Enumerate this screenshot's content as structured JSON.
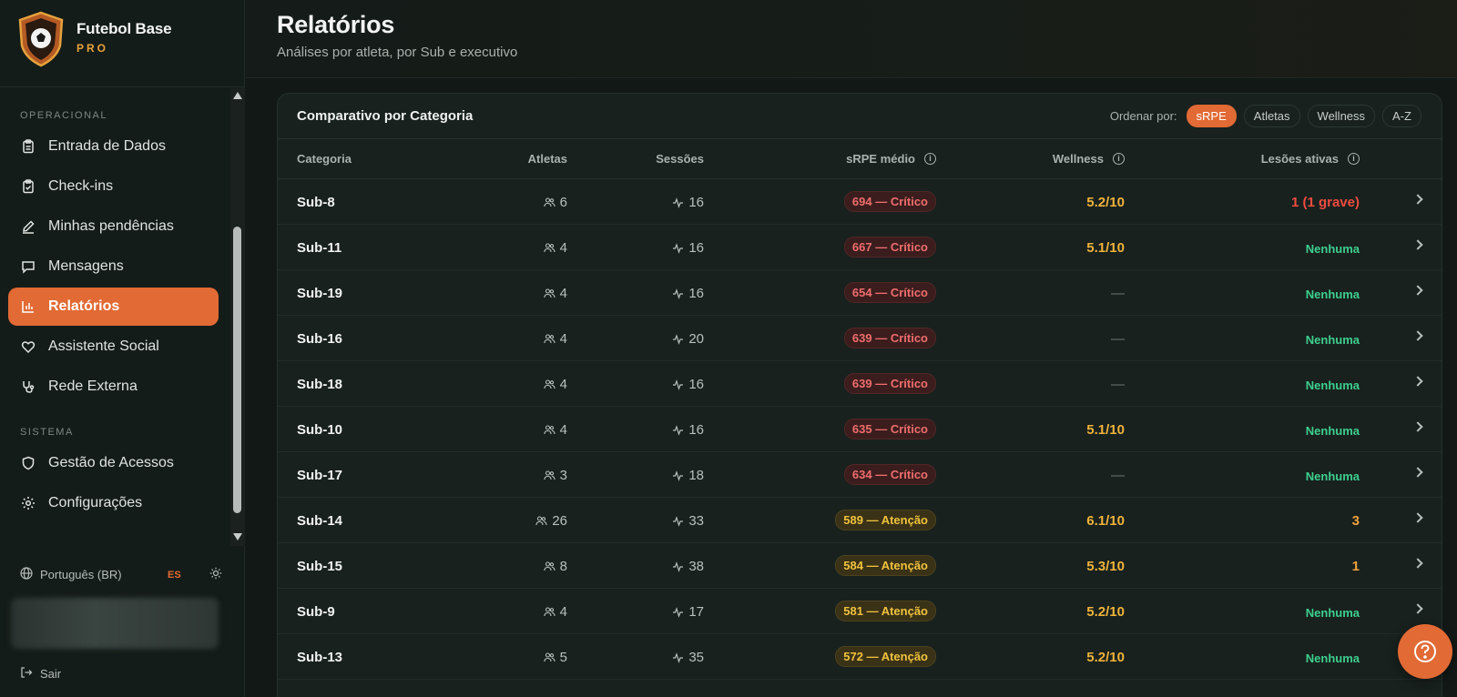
{
  "brand": {
    "name": "Futebol Base",
    "tier": "PRO"
  },
  "sidebar": {
    "sections": [
      {
        "label": "OPERACIONAL"
      },
      {
        "label": "SISTEMA"
      }
    ],
    "items": [
      {
        "label": "Entrada de Dados",
        "icon": "clipboard-icon"
      },
      {
        "label": "Check-ins",
        "icon": "clipboard-check-icon"
      },
      {
        "label": "Minhas pendências",
        "icon": "pencil-icon"
      },
      {
        "label": "Mensagens",
        "icon": "message-icon"
      },
      {
        "label": "Relatórios",
        "icon": "bar-chart-icon",
        "active": true
      },
      {
        "label": "Assistente Social",
        "icon": "heart-icon"
      },
      {
        "label": "Rede Externa",
        "icon": "stethoscope-icon"
      },
      {
        "label": "Gestão de Acessos",
        "icon": "shield-icon"
      },
      {
        "label": "Configurações",
        "icon": "gear-icon"
      }
    ],
    "language": "Português (BR)",
    "alt_language": "ES",
    "logout": "Sair"
  },
  "header": {
    "title": "Relatórios",
    "subtitle": "Análises por atleta, por Sub e executivo"
  },
  "card": {
    "title": "Comparativo por Categoria",
    "sort_label": "Ordenar por:",
    "sort_options": [
      "sRPE",
      "Atletas",
      "Wellness",
      "A-Z"
    ],
    "sort_active": "sRPE",
    "columns": [
      "Categoria",
      "Atletas",
      "Sessões",
      "sRPE médio",
      "Wellness",
      "Lesões ativas"
    ],
    "rows": [
      {
        "cat": "Sub-8",
        "athletes": "6",
        "sessions": "16",
        "srpe": "694 — Crítico",
        "level": "crit",
        "wellness": "5.2/10",
        "injuries": "1 (1 grave)",
        "inj_level": "sev"
      },
      {
        "cat": "Sub-11",
        "athletes": "4",
        "sessions": "16",
        "srpe": "667 — Crítico",
        "level": "crit",
        "wellness": "5.1/10",
        "injuries": "Nenhuma",
        "inj_level": "none"
      },
      {
        "cat": "Sub-19",
        "athletes": "4",
        "sessions": "16",
        "srpe": "654 — Crítico",
        "level": "crit",
        "wellness": "—",
        "injuries": "Nenhuma",
        "inj_level": "none"
      },
      {
        "cat": "Sub-16",
        "athletes": "4",
        "sessions": "20",
        "srpe": "639 — Crítico",
        "level": "crit",
        "wellness": "—",
        "injuries": "Nenhuma",
        "inj_level": "none"
      },
      {
        "cat": "Sub-18",
        "athletes": "4",
        "sessions": "16",
        "srpe": "639 — Crítico",
        "level": "crit",
        "wellness": "—",
        "injuries": "Nenhuma",
        "inj_level": "none"
      },
      {
        "cat": "Sub-10",
        "athletes": "4",
        "sessions": "16",
        "srpe": "635 — Crítico",
        "level": "crit",
        "wellness": "5.1/10",
        "injuries": "Nenhuma",
        "inj_level": "none"
      },
      {
        "cat": "Sub-17",
        "athletes": "3",
        "sessions": "18",
        "srpe": "634 — Crítico",
        "level": "crit",
        "wellness": "—",
        "injuries": "Nenhuma",
        "inj_level": "none"
      },
      {
        "cat": "Sub-14",
        "athletes": "26",
        "sessions": "33",
        "srpe": "589 — Atenção",
        "level": "warn",
        "wellness": "6.1/10",
        "injuries": "3",
        "inj_level": "mid"
      },
      {
        "cat": "Sub-15",
        "athletes": "8",
        "sessions": "38",
        "srpe": "584 — Atenção",
        "level": "warn",
        "wellness": "5.3/10",
        "injuries": "1",
        "inj_level": "mid"
      },
      {
        "cat": "Sub-9",
        "athletes": "4",
        "sessions": "17",
        "srpe": "581 — Atenção",
        "level": "warn",
        "wellness": "5.2/10",
        "injuries": "Nenhuma",
        "inj_level": "none"
      },
      {
        "cat": "Sub-13",
        "athletes": "5",
        "sessions": "35",
        "srpe": "572 — Atenção",
        "level": "warn",
        "wellness": "5.2/10",
        "injuries": "Nenhuma",
        "inj_level": "none"
      }
    ]
  },
  "colors": {
    "accent": "#e26a34",
    "critical": "#ee6d6d",
    "warning": "#f0c23d",
    "ok": "#3ecf8e",
    "wellness": "#f0b33a"
  }
}
